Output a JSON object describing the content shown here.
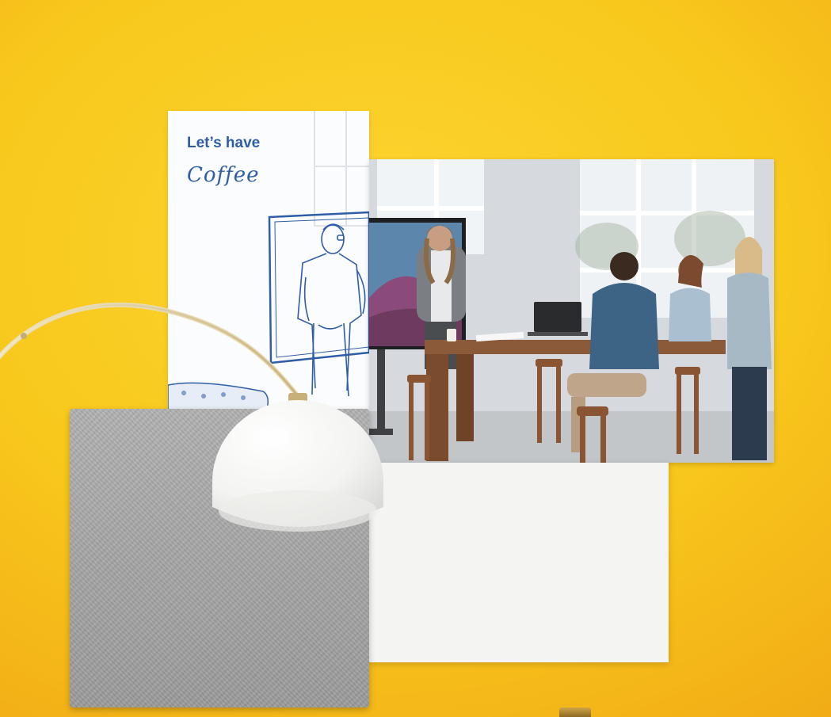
{
  "sketch_card": {
    "title": "Let’s have",
    "subtitle": "Coffee",
    "text_color": "#2f5da6"
  },
  "colors": {
    "background_yellow": "#f8c81c",
    "felt_gray": "#a6a6a6",
    "board_white": "#f4f5f3",
    "lamp_white": "#ffffff"
  },
  "scene": {
    "icons": [
      "arc-floor-lamp-icon",
      "meeting-photo-icon",
      "sketch-illustration-icon"
    ]
  }
}
